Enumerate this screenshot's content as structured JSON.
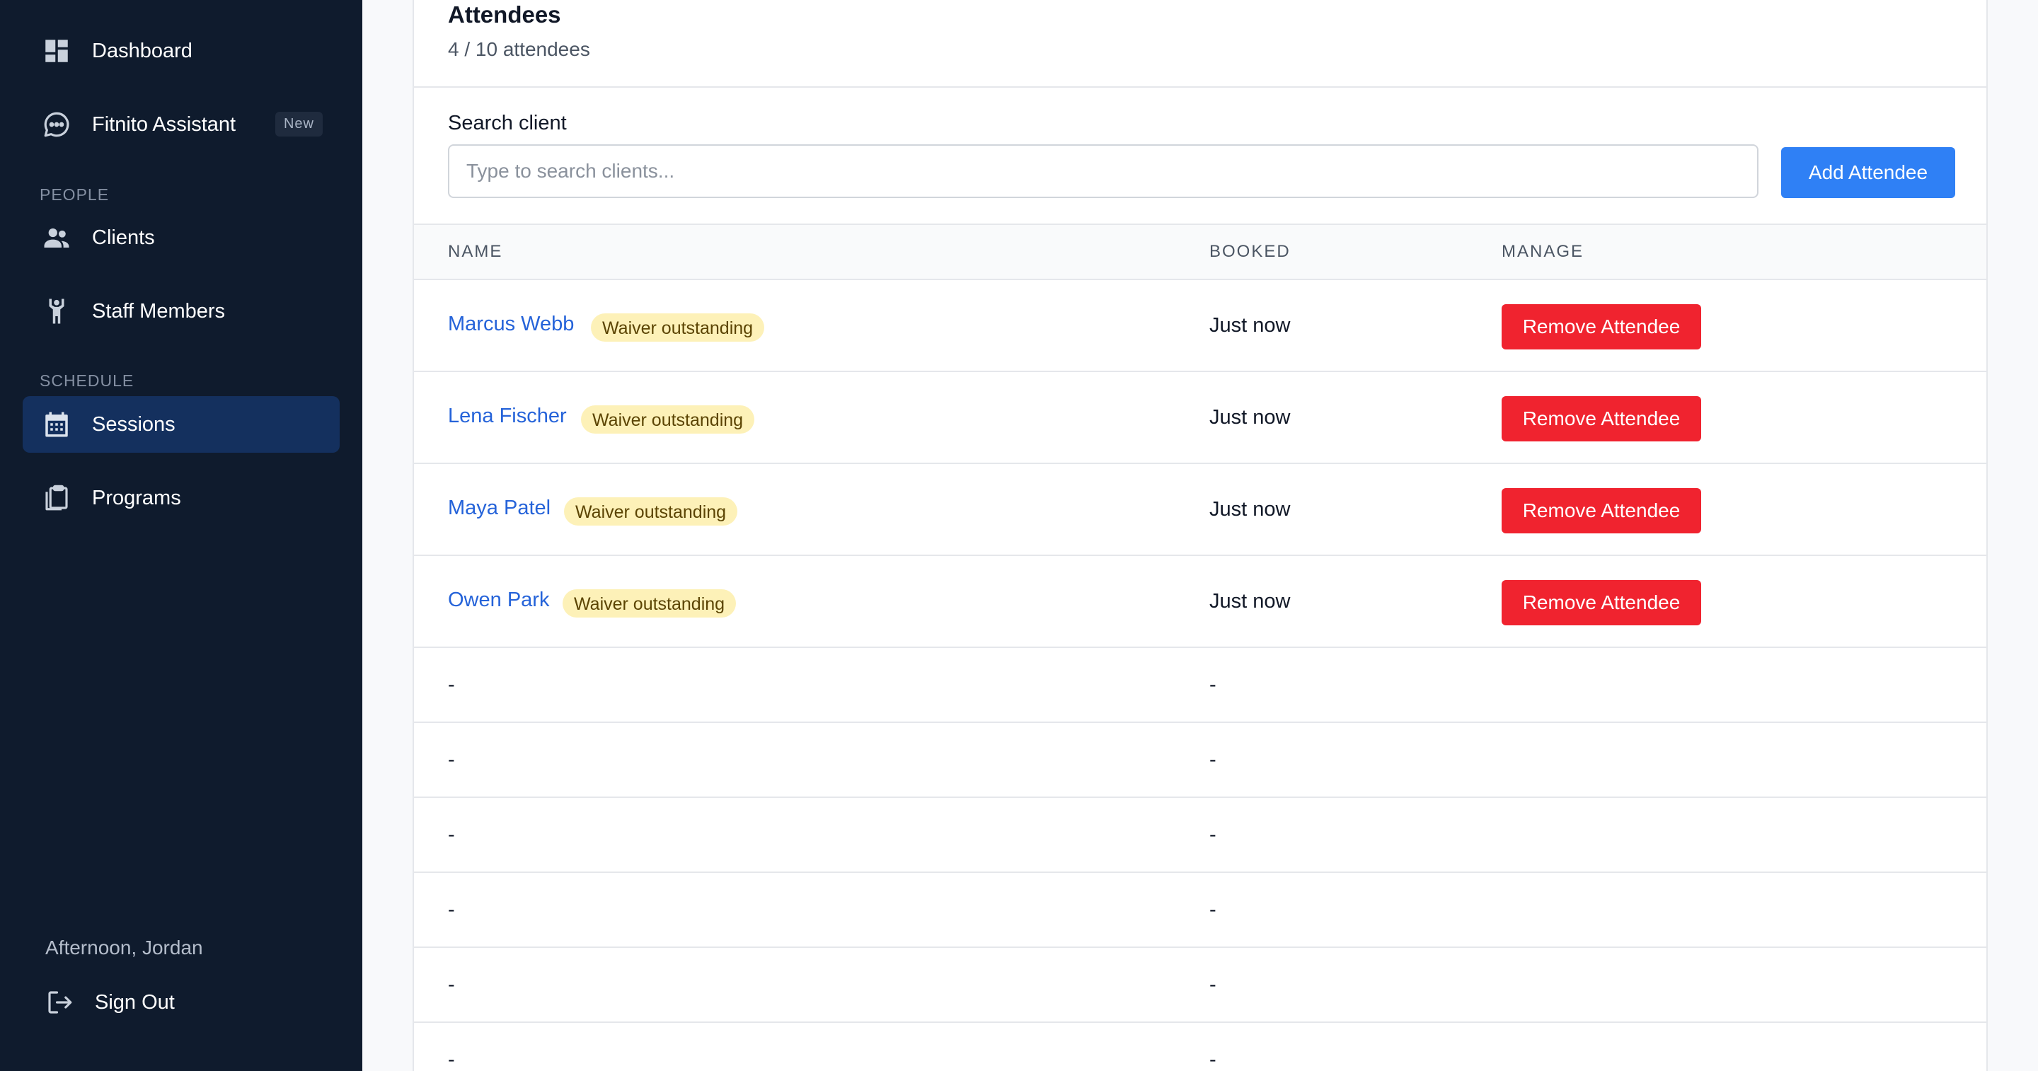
{
  "sidebar": {
    "nav": [
      {
        "label": "Dashboard",
        "icon": "dashboard-icon"
      },
      {
        "label": "Fitnito Assistant",
        "icon": "chat-bubble-icon",
        "badge": "New"
      },
      {
        "label": "Clients",
        "icon": "people-icon"
      },
      {
        "label": "Staff Members",
        "icon": "person-arms-up-icon"
      },
      {
        "label": "Sessions",
        "icon": "calendar-icon",
        "active": true
      },
      {
        "label": "Programs",
        "icon": "clipboard-icon"
      }
    ],
    "sections": {
      "people": "PEOPLE",
      "schedule": "SCHEDULE"
    },
    "greeting": "Afternoon, Jordan",
    "sign_out": {
      "label": "Sign Out",
      "icon": "sign-out-icon"
    }
  },
  "attendees": {
    "title": "Attendees",
    "count_text": "4 / 10 attendees",
    "search": {
      "label": "Search client",
      "placeholder": "Type to search clients...",
      "value": ""
    },
    "add_button": "Add Attendee",
    "columns": {
      "name": "NAME",
      "booked": "BOOKED",
      "manage": "MANAGE"
    },
    "rows": [
      {
        "name": "Marcus Webb",
        "badge": "Waiver outstanding",
        "booked": "Just now",
        "action": "Remove Attendee"
      },
      {
        "name": "Lena Fischer",
        "badge": "Waiver outstanding",
        "booked": "Just now",
        "action": "Remove Attendee"
      },
      {
        "name": "Maya Patel",
        "badge": "Waiver outstanding",
        "booked": "Just now",
        "action": "Remove Attendee"
      },
      {
        "name": "Owen Park",
        "badge": "Waiver outstanding",
        "booked": "Just now",
        "action": "Remove Attendee"
      }
    ],
    "empty_rows": [
      {
        "name": "-",
        "booked": "-"
      },
      {
        "name": "-",
        "booked": "-"
      },
      {
        "name": "-",
        "booked": "-"
      },
      {
        "name": "-",
        "booked": "-"
      },
      {
        "name": "-",
        "booked": "-"
      },
      {
        "name": "-",
        "booked": "-"
      }
    ]
  },
  "colors": {
    "sidebar_bg": "#0f1b2d",
    "active_nav_bg": "#14305e",
    "primary": "#2f80f5",
    "danger": "#f0232f",
    "link": "#2563d9",
    "waiver_badge_bg": "#fdf1b8"
  }
}
